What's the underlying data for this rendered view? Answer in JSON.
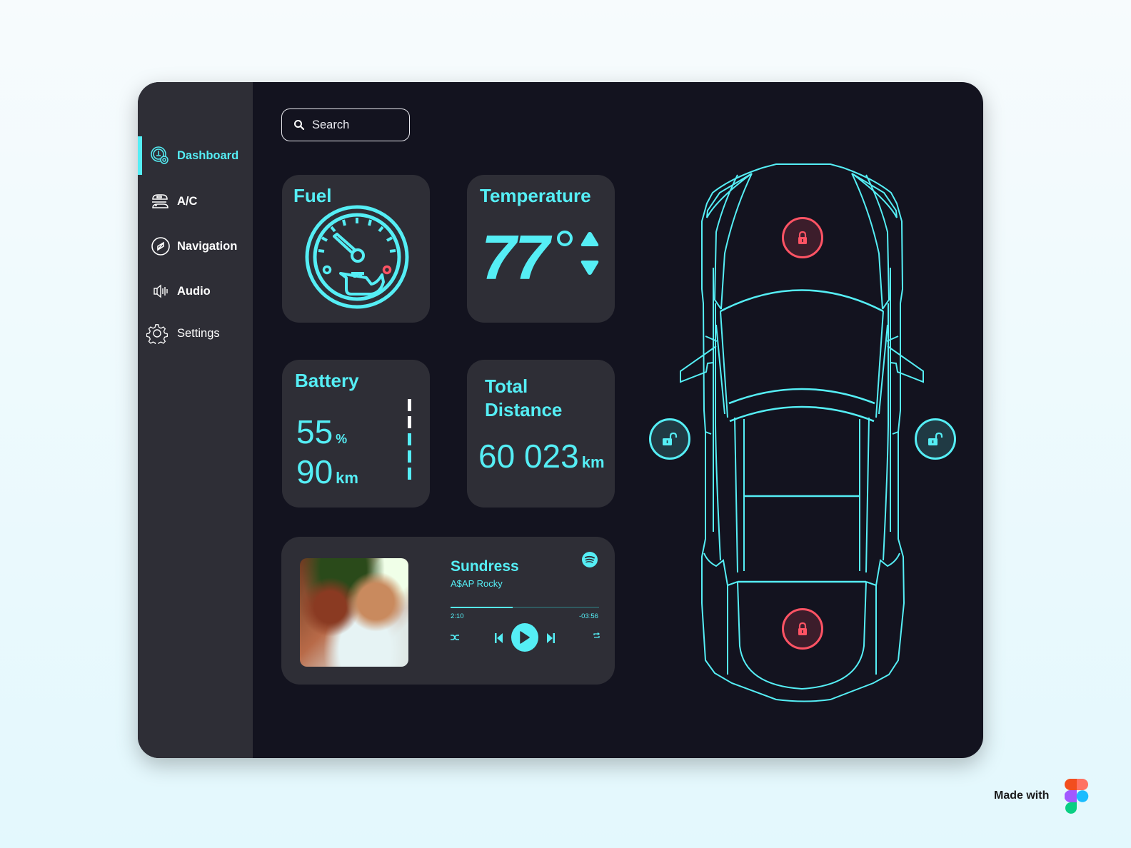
{
  "colors": {
    "accent": "#55eef5",
    "lock_locked": "#ff5364",
    "panel_bg": "#13131f",
    "card_bg": "#2e2e36"
  },
  "sidebar": {
    "items": [
      {
        "label": "Dashboard",
        "icon": "dashboard-gauge-icon",
        "active": true
      },
      {
        "label": "A/C",
        "icon": "ac-icon",
        "active": false
      },
      {
        "label": "Navigation",
        "icon": "compass-icon",
        "active": false
      },
      {
        "label": "Audio",
        "icon": "speaker-icon",
        "active": false
      },
      {
        "label": "Settings",
        "icon": "gear-icon",
        "active": false
      }
    ]
  },
  "search": {
    "placeholder": "Search",
    "value": ""
  },
  "fuel": {
    "title": "Fuel",
    "icon": "fuel-gauge-icon"
  },
  "temperature": {
    "title": "Temperature",
    "value": "77",
    "unit": "°",
    "increase": "increase",
    "decrease": "decrease"
  },
  "battery": {
    "title": "Battery",
    "percent": "55",
    "percent_unit": "%",
    "range": "90",
    "range_unit": "km",
    "level_segments_total": 5,
    "level_segments_filled": 3
  },
  "distance": {
    "title_line1": "Total",
    "title_line2": "Distance",
    "value": "60 023",
    "unit": "km"
  },
  "player": {
    "song": "Sundress",
    "artist": "A$AP Rocky",
    "elapsed": "2:10",
    "remaining": "-03:56",
    "progress": 0.42,
    "service_icon": "spotify-icon"
  },
  "car": {
    "locks": {
      "hood": "locked",
      "trunk": "locked",
      "left_door": "unlocked",
      "right_door": "unlocked"
    }
  },
  "footer": {
    "made_with": "Made with",
    "logo": "figma-logo"
  }
}
